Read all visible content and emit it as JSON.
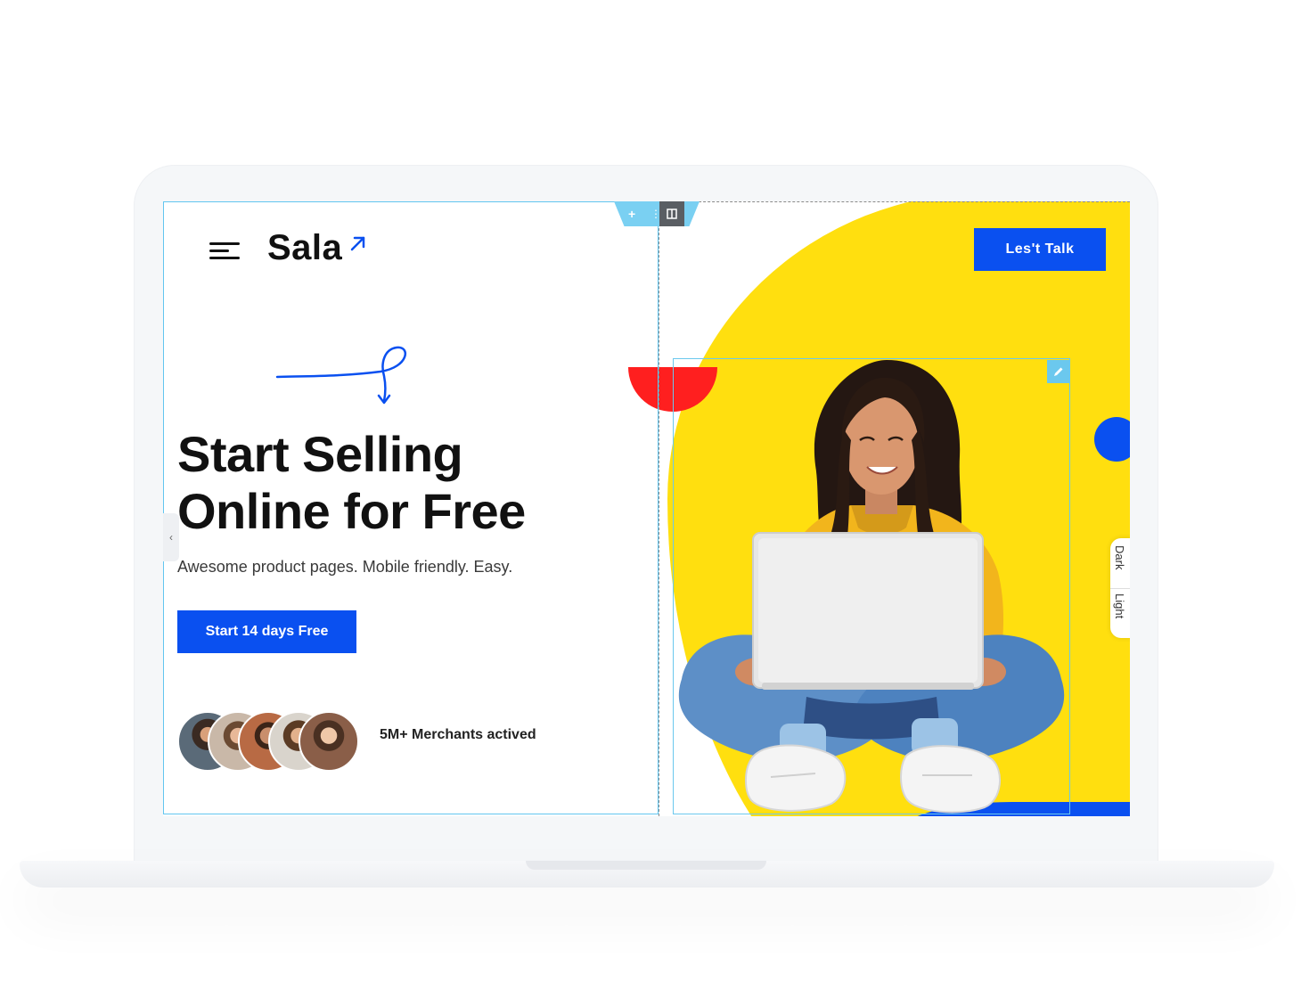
{
  "header": {
    "logo": "Sala",
    "cta_label": "Les't Talk"
  },
  "hero": {
    "title_line1": "Start Selling",
    "title_line2": "Online for Free",
    "subtitle": "Awesome product pages. Mobile friendly. Easy.",
    "primary_cta": "Start 14 days Free"
  },
  "social_proof": {
    "merchants_text": "5M+ Merchants actived"
  },
  "editor": {
    "add_symbol": "+",
    "collapse_symbol": "‹"
  },
  "theme_toggle": {
    "dark_label": "Dark",
    "light_label": "Light"
  },
  "colors": {
    "brand_blue": "#0a50f0",
    "accent_yellow": "#ffdf0f",
    "accent_red": "#ff1f1f",
    "editor_highlight": "#62c6f0"
  },
  "icons": [
    "menu-icon",
    "arrow-up-right-icon",
    "plus-icon",
    "drag-handle-icon",
    "column-icon",
    "pencil-icon",
    "chevron-left-icon"
  ]
}
